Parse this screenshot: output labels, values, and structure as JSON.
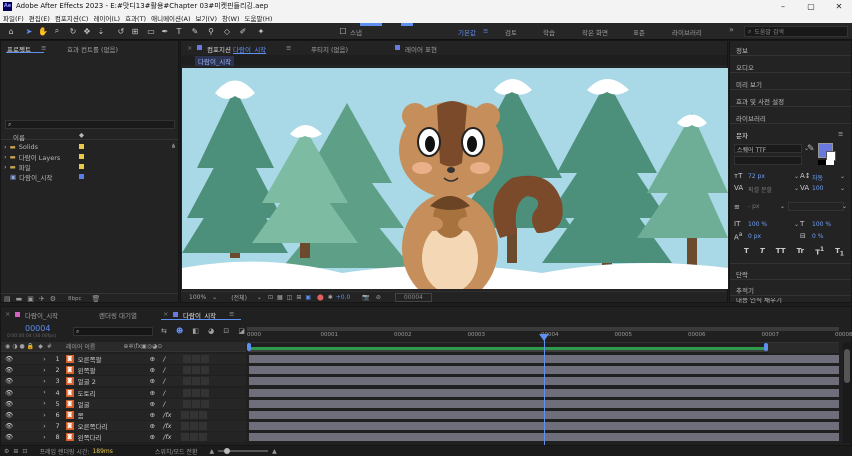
{
  "titlebar": {
    "app_title": "Adobe After Effects 2023 - E:#맛디13#활용#Chapter 03#미켓핀들리깅.aep"
  },
  "menu": [
    "파일(F)",
    "편집(E)",
    "컴포지션(C)",
    "레이어(L)",
    "효과(T)",
    "애니메이션(A)",
    "보기(V)",
    "창(W)",
    "도움말(H)"
  ],
  "toolbar": {
    "snap_label": "스냅",
    "workspaces": [
      "기본값",
      "검토",
      "학습",
      "작은 화면",
      "표준",
      "라이브러리"
    ],
    "active_workspace": "기본값",
    "search_placeholder": "도움말 검색"
  },
  "project": {
    "tab_project": "프로젝트",
    "tab_effects": "효과 컨트롤 (없음)",
    "search_placeholder": "",
    "col_name": "이름",
    "items": [
      {
        "name": "Solids",
        "type": "folder",
        "label_color": "#e8c94a"
      },
      {
        "name": "다람이 Layers",
        "type": "folder",
        "label_color": "#e8c94a"
      },
      {
        "name": "파일",
        "type": "folder",
        "label_color": "#e8c94a"
      },
      {
        "name": "다람이_시작",
        "type": "comp",
        "label_color": "#5c7de8"
      }
    ],
    "bpc": "8bpc"
  },
  "composition": {
    "tab_comp": "컴포지션 다람이_시작",
    "tab_footage": "푸티지 (없음)",
    "tab_layer": "레이어 표현",
    "breadcrumb": "다람이_시작",
    "zoom": "100%",
    "resolution": "(전체)",
    "exposure": "+0.0",
    "timecode": "00004"
  },
  "right_panel": {
    "items": [
      "정보",
      "오디오",
      "미리 보기",
      "효과 및 사전 설정",
      "라이브러리"
    ],
    "char_title": "문자",
    "font_name": "스퀘어 TTF",
    "font_size": "72 px",
    "leading": "자동",
    "kerning": "픽셀 분할",
    "tracking": "100",
    "stroke_width": "- px",
    "vscale": "100 %",
    "hscale": "100 %",
    "baseline": "0 px",
    "tsume": "0 %",
    "type_buttons": [
      "T",
      "T",
      "TT",
      "Tr",
      "T",
      "T"
    ],
    "bottom_items": [
      "단락",
      "추적기",
      "내용 인식 채우기"
    ],
    "fill_color": "#6a79e0",
    "stroke_color": "#ffffff"
  },
  "timeline": {
    "tabs": [
      "다람이_시작",
      "렌더링 대기열",
      "다람이_시작"
    ],
    "timecode": "00004",
    "timecode_sub": "0:00:00:04 (30.00fps)",
    "search_placeholder": "",
    "col_layer_name": "레이어 이름",
    "ruler": [
      "0000",
      "00001",
      "00002",
      "00003",
      "00004",
      "00005",
      "00006",
      "00007",
      "00008"
    ],
    "layers": [
      {
        "num": "1",
        "name": "오른쪽팔"
      },
      {
        "num": "2",
        "name": "왼쪽팔"
      },
      {
        "num": "3",
        "name": "얼굴 2"
      },
      {
        "num": "4",
        "name": "도토리"
      },
      {
        "num": "5",
        "name": "얼굴"
      },
      {
        "num": "6",
        "name": "몸"
      },
      {
        "num": "7",
        "name": "오른쪽다리"
      },
      {
        "num": "8",
        "name": "왼쪽다리"
      }
    ],
    "status_render": "프레임 렌더링 시간:",
    "status_render_value": "189ms",
    "status_toggle": "스위치/모드 전환"
  }
}
